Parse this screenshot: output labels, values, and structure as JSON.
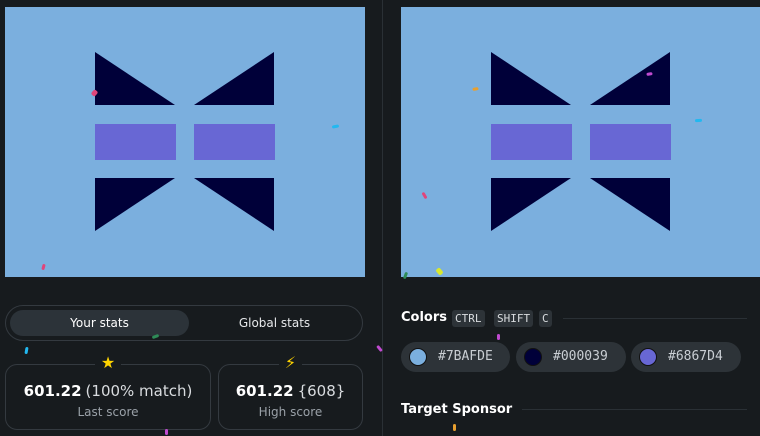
{
  "colors": {
    "background": "#7BAFDE",
    "shape_dark": "#000039",
    "shape_accent": "#6867D4",
    "page_bg": "#171b1e"
  },
  "stats_tabs": [
    {
      "label": "Your stats",
      "active": true
    },
    {
      "label": "Global stats",
      "active": false
    }
  ],
  "last_score": {
    "icon": "star-icon",
    "value": "601.22",
    "detail": "(100% match)",
    "label": "Last score"
  },
  "high_score": {
    "icon": "lightning-icon",
    "value": "601.22",
    "detail": "{608}",
    "label": "High score"
  },
  "colors_section": {
    "title": "Colors",
    "shortcut_keys": [
      "CTRL",
      "SHIFT",
      "C"
    ],
    "swatches": [
      {
        "hex": "#7BAFDE"
      },
      {
        "hex": "#000039"
      },
      {
        "hex": "#6867D4"
      }
    ]
  },
  "sponsor_section": {
    "title": "Target Sponsor"
  }
}
